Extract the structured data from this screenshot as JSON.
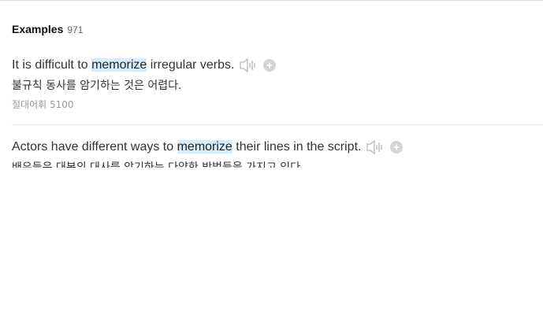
{
  "examples_section": {
    "title": "Examples",
    "count": "971",
    "items": [
      {
        "sentence_before": "It is difficult to ",
        "highlight": "memorize",
        "sentence_after": " irregular verbs.",
        "translation": "불규칙 동사를 암기하는 것은 어렵다.",
        "source": "절대어휘 5100"
      },
      {
        "sentence_before": "Actors have different ways to ",
        "highlight": "memorize",
        "sentence_after": " their lines in the script.",
        "translation": "배우들은 대본의 대사를 암기하는 다양한 방법들을 가지고 있다."
      }
    ]
  },
  "icons": {
    "audio": "speaker-icon",
    "add": "plus-circle-icon"
  },
  "colors": {
    "highlight_bg": "#d7ecfb",
    "icon_gray": "#c8c8c8",
    "source_text": "#999999"
  }
}
